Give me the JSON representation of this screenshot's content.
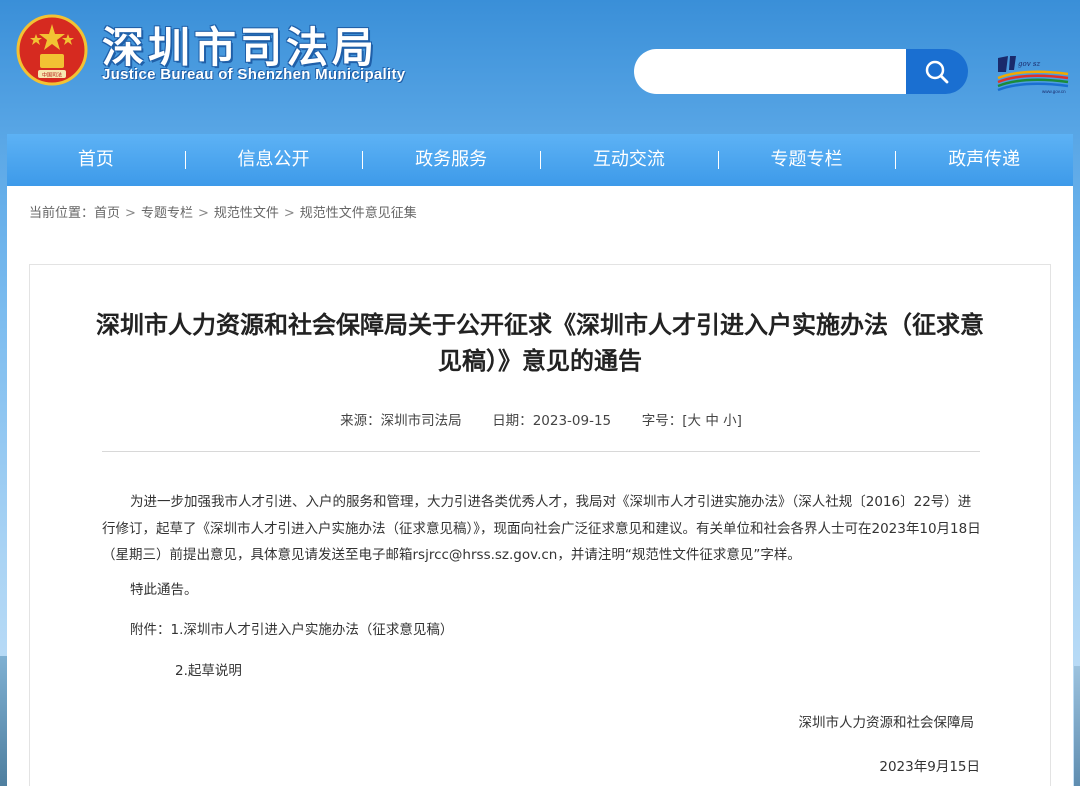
{
  "header": {
    "title_cn": "深圳市司法局",
    "title_en": "Justice Bureau of Shenzhen Municipality",
    "emblem_icon": "national-emblem-icon",
    "emblem_caption": "中国司法",
    "search": {
      "placeholder": "",
      "button_icon": "search-icon"
    },
    "sz_logo": {
      "icon": "shenzhen-china-logo-icon",
      "caption": "www.gov.cn"
    }
  },
  "nav": {
    "items": [
      {
        "label": "首页"
      },
      {
        "label": "信息公开"
      },
      {
        "label": "政务服务"
      },
      {
        "label": "互动交流"
      },
      {
        "label": "专题专栏"
      },
      {
        "label": "政声传递"
      }
    ]
  },
  "breadcrumb": {
    "prefix": "当前位置：",
    "items": [
      "首页",
      "专题专栏",
      "规范性文件",
      "规范性文件意见征集"
    ],
    "separator": ">"
  },
  "article": {
    "title": "深圳市人力资源和社会保障局关于公开征求《深圳市人才引进入户实施办法（征求意见稿）》意见的通告",
    "meta": {
      "source_label": "来源：",
      "source": "深圳市司法局",
      "date_label": "日期：",
      "date": "2023-09-15",
      "size_label": "字号：",
      "size_open": "[",
      "size_large": "大",
      "size_medium": "中",
      "size_small": "小",
      "size_close": "]"
    },
    "paragraph1": "为进一步加强我市人才引进、入户的服务和管理，大力引进各类优秀人才，我局对《深圳市人才引进实施办法》（深人社规〔2016〕22号）进行修订，起草了《深圳市人才引进入户实施办法（征求意见稿）》，现面向社会广泛征求意见和建议。有关单位和社会各界人士可在2023年10月18日（星期三）前提出意见，具体意见请发送至电子邮箱rsjrcc@hrss.sz.gov.cn，并请注明“规范性文件征求意见”字样。",
    "paragraph2": "特此通告。",
    "attachment1": "附件：1.深圳市人才引进入户实施办法（征求意见稿）",
    "attachment2": "2.起草说明",
    "signer": "深圳市人力资源和社会保障局",
    "sign_date": "2023年9月15日"
  },
  "colors": {
    "nav_bg": "#3d9ae9",
    "search_button": "#1a6fd1",
    "title_text": "#222222"
  }
}
